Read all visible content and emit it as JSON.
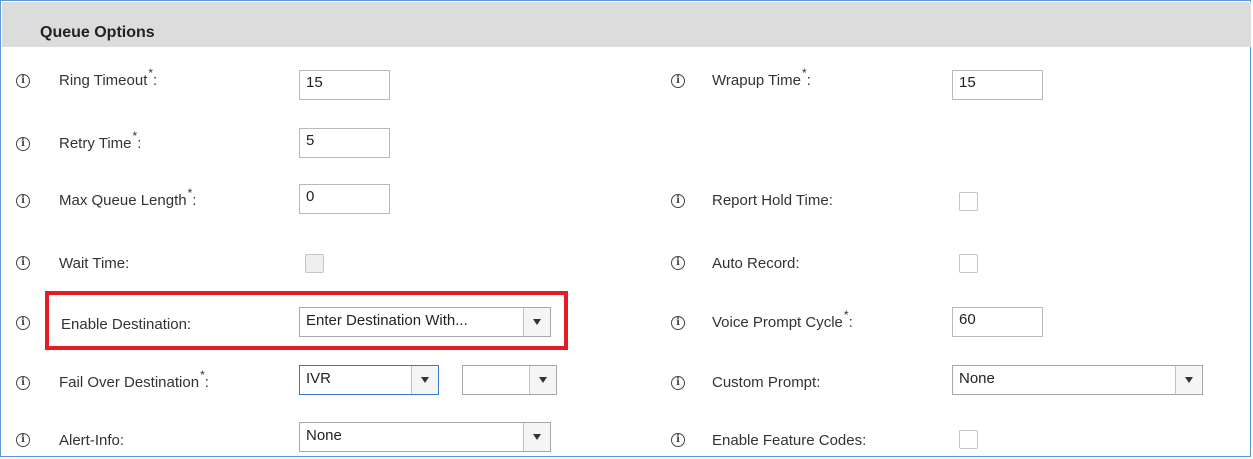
{
  "header": {
    "title": "Queue Options"
  },
  "fields": {
    "ring_timeout": {
      "label": "Ring Timeout",
      "required": "*",
      "colon": ":",
      "value": "15"
    },
    "wrapup_time": {
      "label": "Wrapup Time",
      "required": "*",
      "colon": ":",
      "value": "15"
    },
    "retry_time": {
      "label": "Retry Time",
      "required": "*",
      "colon": ":",
      "value": "5"
    },
    "max_queue_length": {
      "label": "Max Queue Length",
      "required": "*",
      "colon": ":",
      "value": "0"
    },
    "report_hold_time": {
      "label": "Report Hold Time:"
    },
    "wait_time": {
      "label": "Wait Time:"
    },
    "auto_record": {
      "label": "Auto Record:"
    },
    "enable_destination": {
      "label": "Enable Destination:",
      "value": "Enter Destination With..."
    },
    "voice_prompt_cycle": {
      "label": "Voice Prompt Cycle",
      "required": "*",
      "colon": ":",
      "value": "60"
    },
    "fail_over_destination": {
      "label": "Fail Over Destination",
      "required": "*",
      "colon": ":",
      "value": "IVR",
      "secondary_value": ""
    },
    "custom_prompt": {
      "label": "Custom Prompt:",
      "value": "None"
    },
    "alert_info": {
      "label": "Alert-Info:",
      "value": "None"
    },
    "enable_feature_codes": {
      "label": "Enable Feature Codes:"
    }
  },
  "icons": {
    "info": "i"
  },
  "colors": {
    "highlight": "#e51c23",
    "header_bg": "#dcdcdc",
    "frame_border": "#5b9bd5"
  }
}
